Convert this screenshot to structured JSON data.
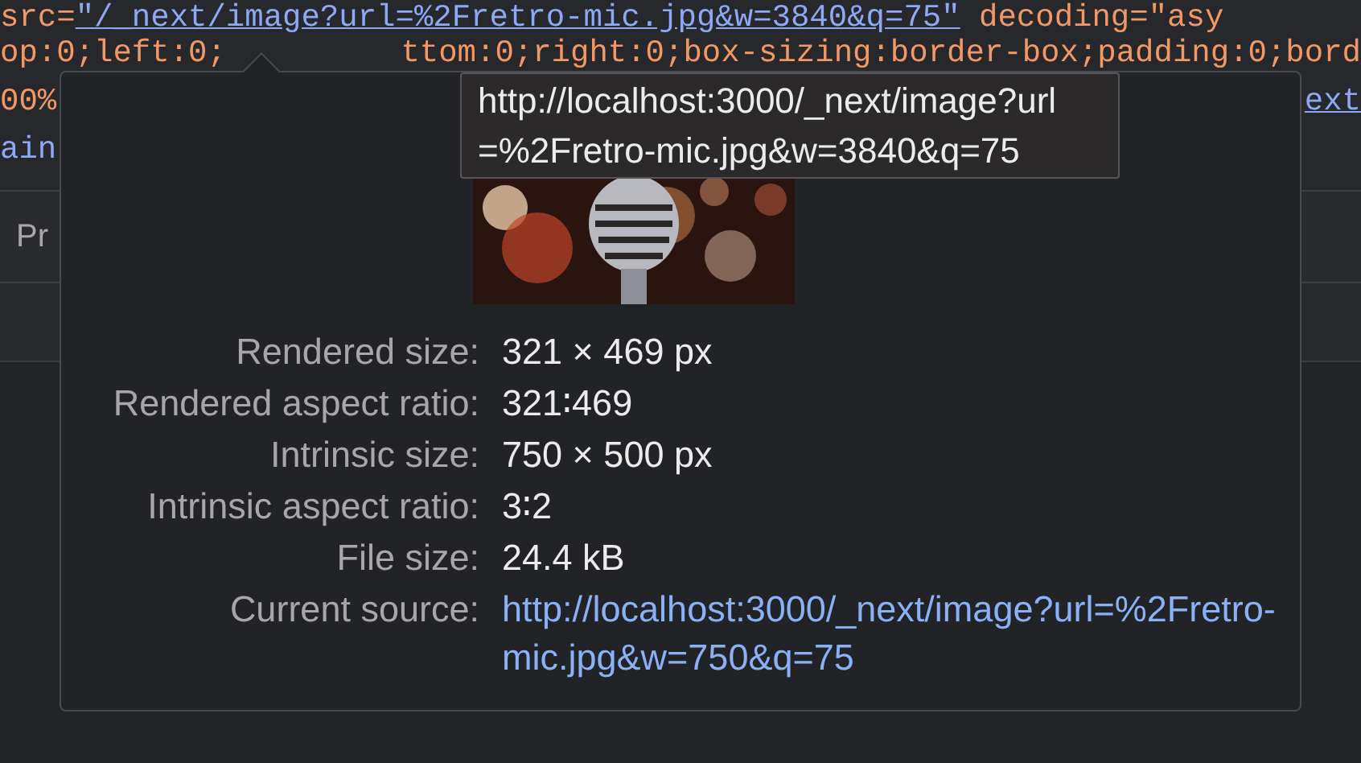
{
  "code_lines": [
    [
      {
        "kind": "attr",
        "text": "src="
      },
      {
        "kind": "link",
        "text": "\"/_next/image?url=%2Fretro-mic.jpg&w=3840&q=75\""
      },
      {
        "kind": "attr",
        "text": " decoding="
      },
      {
        "kind": "attr",
        "text": "\"asy"
      }
    ],
    [
      {
        "kind": "attr",
        "text": "op:0;left:0;"
      },
      {
        "kind": "gap"
      },
      {
        "kind": "attr",
        "text": "ttom:0;right:0;box-sizing:border-box;padding:0;bord"
      }
    ],
    [
      {
        "kind": "attr",
        "text": "00%"
      },
      {
        "kind": "gap"
      },
      {
        "kind": "link",
        "text": "ext"
      }
    ],
    [
      {
        "kind": "plain",
        "text": "ain"
      }
    ]
  ],
  "tab": {
    "label": "Pr"
  },
  "popover": {
    "tooltip": "http://localhost:3000/_next/image?url=%2Fretro-mic.jpg&w=3840&q=75",
    "rows": [
      {
        "kind": "text",
        "label": "Rendered size:",
        "value": "321 × 469 px"
      },
      {
        "kind": "text",
        "label": "Rendered aspect ratio:",
        "value": "321∶469"
      },
      {
        "kind": "text",
        "label": "Intrinsic size:",
        "value": "750 × 500 px"
      },
      {
        "kind": "text",
        "label": "Intrinsic aspect ratio:",
        "value": "3∶2"
      },
      {
        "kind": "text",
        "label": "File size:",
        "value": "24.4 kB"
      },
      {
        "kind": "link",
        "label": "Current source:",
        "value": "http://localhost:3000/_next/image?url=%2Fretro-mic.jpg&w=750&q=75"
      }
    ]
  }
}
